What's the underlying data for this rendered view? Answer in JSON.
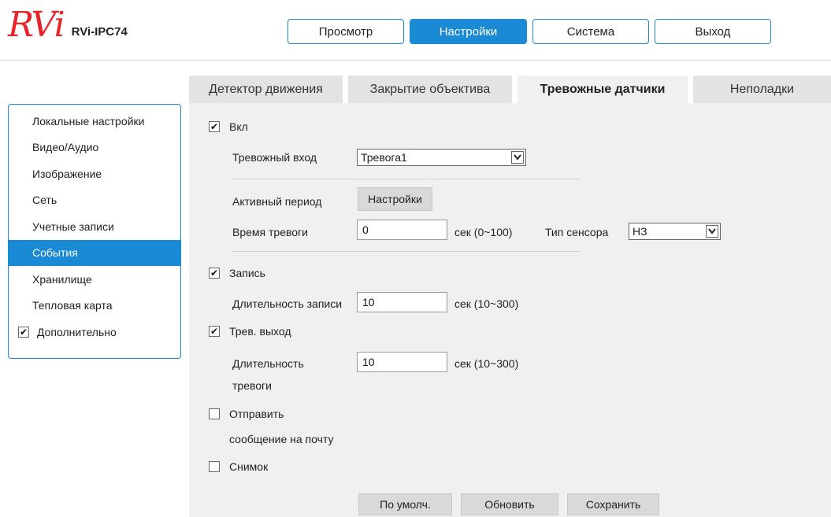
{
  "header": {
    "logo_text": "RVi",
    "model": "RVi-IPC74",
    "nav": [
      {
        "label": "Просмотр",
        "active": false
      },
      {
        "label": "Настройки",
        "active": true
      },
      {
        "label": "Система",
        "active": false
      },
      {
        "label": "Выход",
        "active": false
      }
    ]
  },
  "sidebar": {
    "items": [
      {
        "label": "Локальные настройки"
      },
      {
        "label": "Видео/Аудио"
      },
      {
        "label": "Изображение"
      },
      {
        "label": "Сеть"
      },
      {
        "label": "Учетные записи"
      },
      {
        "label": "События",
        "active": true
      },
      {
        "label": "Хранилище"
      },
      {
        "label": "Тепловая карта"
      }
    ],
    "advanced": {
      "label": "Дополнительно",
      "checked": true
    }
  },
  "tabs": [
    {
      "label": "Детектор движения"
    },
    {
      "label": "Закрытие объектива"
    },
    {
      "label": "Тревожные датчики",
      "active": true
    },
    {
      "label": "Неполадки"
    }
  ],
  "form": {
    "enable": {
      "label": "Вкл",
      "checked": true
    },
    "alarm_input": {
      "label": "Тревожный вход",
      "value": "Тревога1"
    },
    "active_period": {
      "label": "Активный период",
      "button": "Настройки"
    },
    "alarm_time": {
      "label": "Время тревоги",
      "value": "0",
      "unit": "сек (0~100)"
    },
    "sensor_type": {
      "label": "Тип сенсора",
      "value": "НЗ"
    },
    "record": {
      "label": "Запись",
      "checked": true
    },
    "record_duration": {
      "label": "Длительность записи",
      "value": "10",
      "unit": "сек (10~300)"
    },
    "alarm_out": {
      "label": "Трев. выход",
      "checked": true
    },
    "alarm_duration": {
      "label_line1": "Длительность",
      "label_line2": "тревоги",
      "value": "10",
      "unit": "сек (10~300)"
    },
    "send_email": {
      "label_line1": "Отправить",
      "label_line2": "сообщение на почту",
      "checked": false
    },
    "snapshot": {
      "label": "Снимок",
      "checked": false
    }
  },
  "buttons": {
    "default": "По умолч.",
    "refresh": "Обновить",
    "save": "Сохранить"
  },
  "colors": {
    "accent": "#1a8ad4",
    "logo": "#e8242a",
    "panel": "#f0f0f0"
  }
}
